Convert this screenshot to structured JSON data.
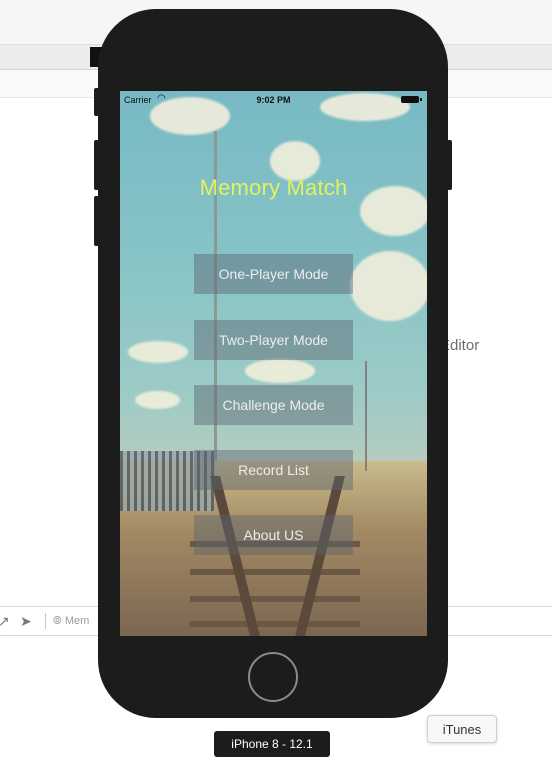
{
  "device": {
    "label": "iPhone 8 - 12.1",
    "status_bar": {
      "carrier": "Carrier",
      "time": "9:02 PM"
    }
  },
  "app": {
    "title": "Memory Match",
    "title_color": "#e2f25d",
    "menu": [
      {
        "label": "One-Player Mode"
      },
      {
        "label": "Two-Player Mode"
      },
      {
        "label": "Challenge Mode"
      },
      {
        "label": "Record List"
      },
      {
        "label": "About US"
      }
    ]
  },
  "background_window": {
    "editor_text": "Editor",
    "bottom_bar_text": "Mem"
  },
  "tooltip": {
    "text": "iTunes"
  },
  "icons": [
    "wifi-icon",
    "battery-icon",
    "location-arrow-icon",
    "memory-graph-icon",
    "home-button"
  ]
}
